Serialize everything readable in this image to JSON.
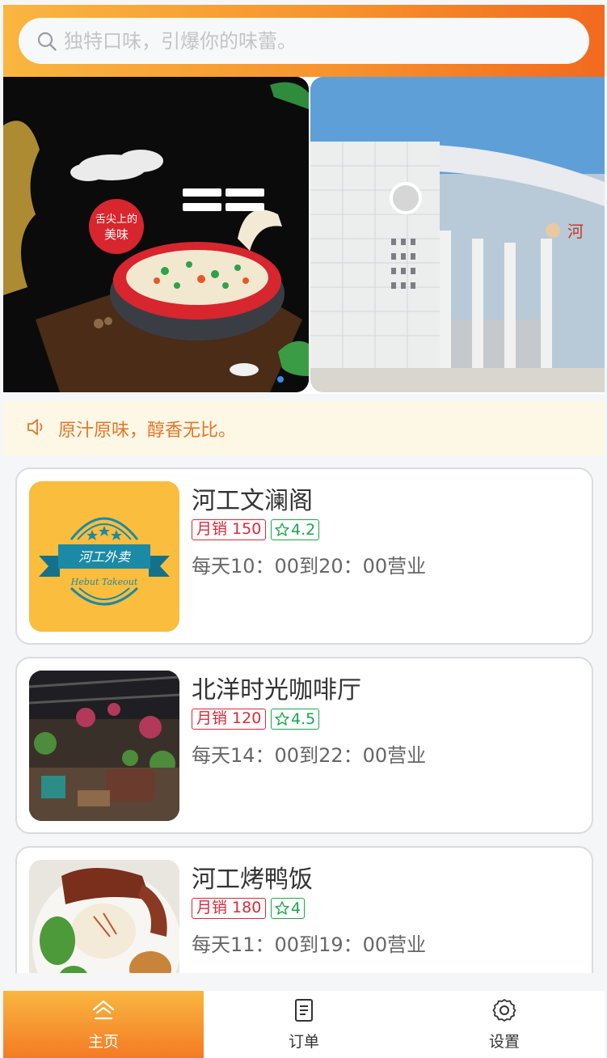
{
  "search": {
    "placeholder": "独特口味，引爆你的味蕾。",
    "icon": "search-icon"
  },
  "banner": {
    "slides": [
      {
        "name": "food-promo",
        "badge": "舌尖上的美味"
      },
      {
        "name": "campus-gate"
      }
    ]
  },
  "notice": {
    "icon": "speaker-icon",
    "text": "原汁原味，醇香无比。"
  },
  "shops": [
    {
      "name": "河工文澜阁",
      "sales": "月销 150",
      "rating": "4.2",
      "hours": "每天10：00到20：00营业",
      "logo_text": "河工外卖",
      "logo_sub": "Hebut Takeout"
    },
    {
      "name": "北洋时光咖啡厅",
      "sales": "月销 120",
      "rating": "4.5",
      "hours": "每天14：00到22：00营业"
    },
    {
      "name": "河工烤鸭饭",
      "sales": "月销 180",
      "rating": "4",
      "hours": "每天11：00到19：00营业"
    }
  ],
  "tabbar": {
    "items": [
      {
        "label": "主页",
        "icon": "home-icon",
        "active": true
      },
      {
        "label": "订单",
        "icon": "document-icon",
        "active": false
      },
      {
        "label": "设置",
        "icon": "gear-icon",
        "active": false
      }
    ]
  },
  "colors": {
    "accent_start": "#f9b640",
    "accent_end": "#f26a1f",
    "sales_tag": "#d9293b",
    "rating_tag": "#1aa74f",
    "notice_bg": "#fdf8e6",
    "notice_text": "#e4762a"
  }
}
